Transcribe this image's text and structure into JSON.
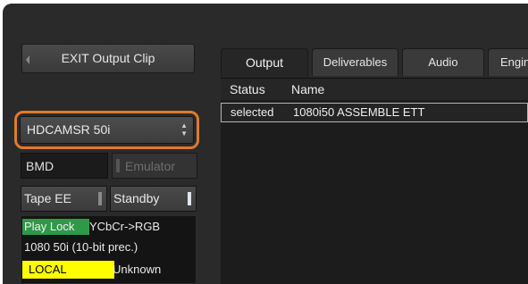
{
  "left_panel": {
    "exit_label": "EXIT Output Clip",
    "format_select": {
      "value": "HDCAMSR 50i"
    },
    "device_label": "BMD",
    "emulator_label": "Emulator",
    "tape_ee_label": "Tape EE",
    "standby_label": "Standby",
    "status": {
      "play_lock": "Play Lock",
      "conversion": "YCbCr->RGB",
      "format": "1080 50i (10-bit prec.)",
      "local": "LOCAL",
      "unknown": "Unknown"
    }
  },
  "tabs": [
    {
      "label": "Output",
      "active": true
    },
    {
      "label": "Deliverables"
    },
    {
      "label": "Audio"
    },
    {
      "label": "Engin"
    }
  ],
  "table": {
    "columns": [
      "Status",
      "Name"
    ],
    "rows": [
      {
        "status": "selected",
        "name": "1080i50 ASSEMBLE ETT"
      }
    ]
  },
  "colors": {
    "highlight_ring": "#e07a2e",
    "play_lock_bg": "#2d9a47",
    "local_bg": "#ffff00"
  }
}
